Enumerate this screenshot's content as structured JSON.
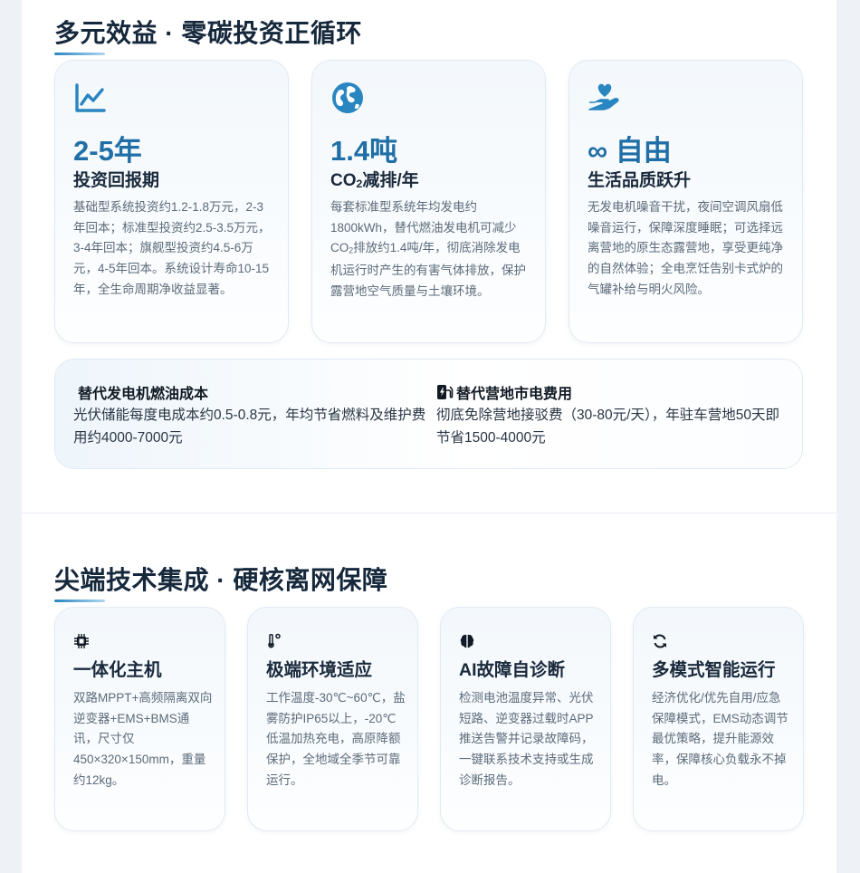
{
  "benefits": {
    "title": "多元效益 · 零碳投资正循环",
    "cards": [
      {
        "icon": "chart-line-icon",
        "value": "2-5年",
        "label": "投资回报期",
        "desc": "基础型系统投资约1.2-1.8万元，2-3年回本；标准型投资约2.5-3.5万元，3-4年回本；旗舰型投资约4.5-6万元，4-5年回本。系统设计寿命10-15年，全生命周期净收益显著。"
      },
      {
        "icon": "earth-icon",
        "value": "1.4吨",
        "label_pre": "CO",
        "label_sub": "2",
        "label_post": "减排/年",
        "desc_pre": "每套标准型系统年均发电约1800kWh，替代燃油发电机可减少CO",
        "desc_sub": "2",
        "desc_post": "排放约1.4吨/年，彻底消除发电机运行时产生的有害气体排放，保护露营地空气质量与土壤环境。"
      },
      {
        "icon": "hand-heart-icon",
        "value": "∞ 自由",
        "label": "生活品质跃升",
        "desc": "无发电机噪音干扰，夜间空调风扇低噪音运行，保障深度睡眠；可选择远离营地的原生态露营地，享受更纯净的自然体验；全电烹饪告别卡式炉的气罐补给与明火风险。"
      }
    ]
  },
  "savings": [
    {
      "icon": "",
      "title": "替代发电机燃油成本",
      "desc": "光伏储能每度电成本约0.5-0.8元，年均节省燃料及维护费用约4000-7000元"
    },
    {
      "icon": "charging-station-icon",
      "title": "替代营地市电费用",
      "desc": "彻底免除营地接驳费（30-80元/天），年驻车营地50天即节省1500-4000元"
    }
  ],
  "tech": {
    "title": "尖端技术集成 · 硬核离网保障",
    "cards": [
      {
        "icon": "chip-icon",
        "name": "一体化主机",
        "desc": "双路MPPT+高频隔离双向逆变器+EMS+BMS通讯，尺寸仅450×320×150mm，重量约12kg。"
      },
      {
        "icon": "thermometer-icon",
        "name": "极端环境适应",
        "desc": "工作温度-30℃~60℃，盐雾防护IP65以上，-20℃低温加热充电，高原降额保护，全地域全季节可靠运行。"
      },
      {
        "icon": "brain-icon",
        "name": "AI故障自诊断",
        "desc": "检测电池温度异常、光伏短路、逆变器过载时APP推送告警并记录故障码，一键联系技术支持或生成诊断报告。"
      },
      {
        "icon": "sync-icon",
        "name": "多模式智能运行",
        "desc": "经济优化/优先自用/应急保障模式，EMS动态调节最优策略，提升能源效率，保障核心负载永不掉电。"
      }
    ]
  },
  "colors": {
    "accent": "#1f6fa6",
    "icon_blue": "#2a86c0",
    "heading": "#16283c",
    "body_text": "#5c6b7a"
  }
}
